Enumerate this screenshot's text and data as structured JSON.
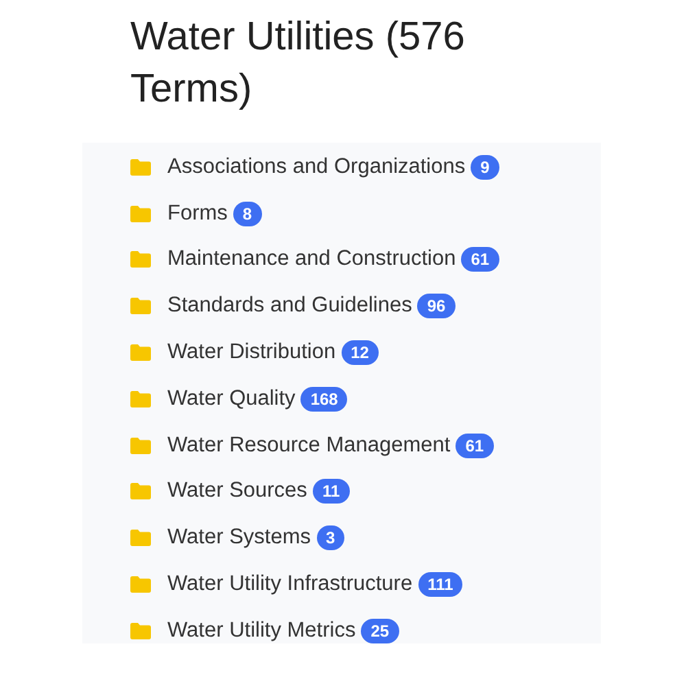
{
  "title": "Water Utilities (576 Terms)",
  "categories": [
    {
      "label": "Associations and Organizations",
      "count": "9"
    },
    {
      "label": "Forms",
      "count": "8"
    },
    {
      "label": "Maintenance and Construction",
      "count": "61"
    },
    {
      "label": "Standards and Guidelines",
      "count": "96"
    },
    {
      "label": "Water Distribution",
      "count": "12"
    },
    {
      "label": "Water Quality",
      "count": "168"
    },
    {
      "label": "Water Resource Management",
      "count": "61"
    },
    {
      "label": "Water Sources",
      "count": "11"
    },
    {
      "label": "Water Systems",
      "count": "3"
    },
    {
      "label": "Water Utility Infrastructure",
      "count": "111"
    },
    {
      "label": "Water Utility Metrics",
      "count": "25"
    }
  ]
}
